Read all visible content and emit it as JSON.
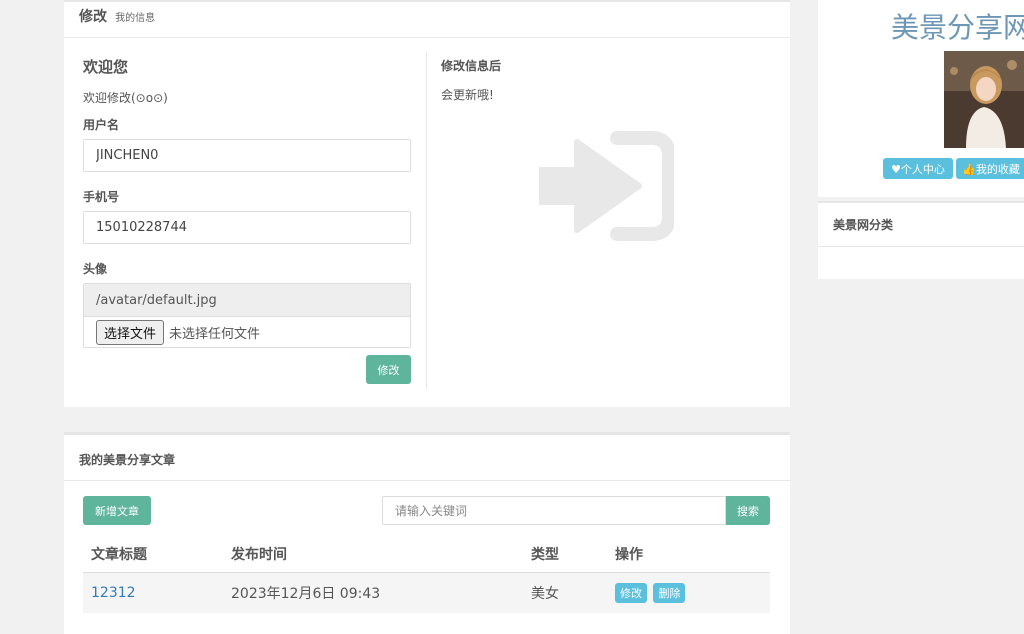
{
  "edit_panel": {
    "title": "修改",
    "subtitle": "我的信息",
    "welcome_title": "欢迎您",
    "welcome_sub": "欢迎修改(⊙o⊙)",
    "username_label": "用户名",
    "username_value": "JINCHEN0",
    "phone_label": "手机号",
    "phone_value": "15010228744",
    "avatar_label": "头像",
    "avatar_path": "/avatar/default.jpg",
    "file_button": "选择文件",
    "file_status": "未选择任何文件",
    "submit_label": "修改",
    "info_title": "修改信息后",
    "info_sub": "会更新哦!",
    "icon": "sign-in-icon"
  },
  "articles_panel": {
    "title": "我的美景分享文章",
    "add_label": "新增文章",
    "search_placeholder": "请输入关键词",
    "search_label": "搜索",
    "columns": [
      "文章标题",
      "发布时间",
      "类型",
      "操作"
    ],
    "rows": [
      {
        "title": "12312",
        "date": "2023年12月6日 09:43",
        "type": "美女",
        "edit": "修改",
        "delete": "删除"
      }
    ]
  },
  "sidebar": {
    "brand": "美景分享网",
    "btn_center": "♥个人中心",
    "btn_fav": "👍我的收藏",
    "category_title": "美景网分类"
  },
  "colors": {
    "green": "#5fb49c",
    "info": "#5bc0de",
    "link": "#337ab7",
    "brand": "#6d97b4"
  }
}
